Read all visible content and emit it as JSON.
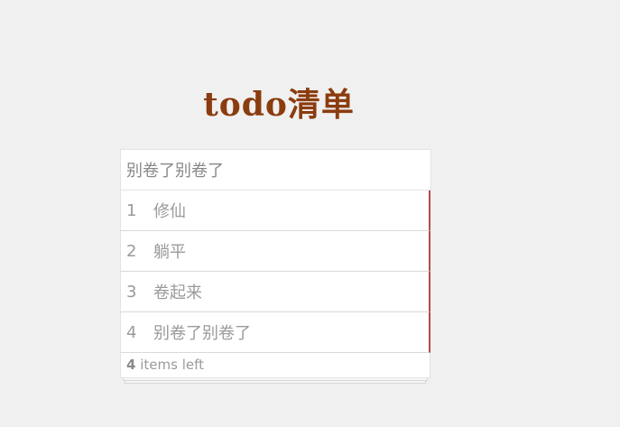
{
  "title": {
    "latin": "todo",
    "cn": "清单"
  },
  "input": {
    "value": "别卷了别卷了"
  },
  "todos": [
    {
      "num": "1",
      "text": "修仙"
    },
    {
      "num": "2",
      "text": "躺平"
    },
    {
      "num": "3",
      "text": "卷起来"
    },
    {
      "num": "4",
      "text": "别卷了别卷了"
    }
  ],
  "footer": {
    "count": "4",
    "label": "items left"
  },
  "colors": {
    "title": "#8b3c0e",
    "background": "#f0f0f0",
    "item_accent": "#b24a4a"
  }
}
